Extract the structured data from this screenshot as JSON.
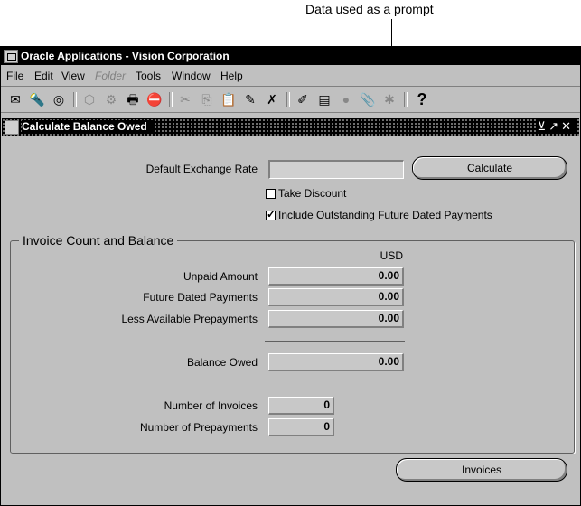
{
  "annotation": {
    "text": "Data used as a prompt"
  },
  "window": {
    "title": "Oracle Applications - Vision Corporation"
  },
  "menu": [
    {
      "label": "File",
      "disabled": false
    },
    {
      "label": "Edit",
      "disabled": false
    },
    {
      "label": "View",
      "disabled": false
    },
    {
      "label": "Folder",
      "disabled": true
    },
    {
      "label": "Tools",
      "disabled": false
    },
    {
      "label": "Window",
      "disabled": false
    },
    {
      "label": "Help",
      "disabled": false
    }
  ],
  "form": {
    "title": "Calculate Balance Owed",
    "exchange_rate_label": "Default Exchange Rate",
    "exchange_rate_value": "",
    "calculate_button": "Calculate",
    "take_discount_label": "Take Discount",
    "take_discount_checked": false,
    "include_future_label": "Include Outstanding Future Dated Payments",
    "include_future_checked": true,
    "group_title": "Invoice Count and Balance",
    "currency": "USD",
    "unpaid_label": "Unpaid Amount",
    "unpaid_value": "0.00",
    "future_label": "Future Dated Payments",
    "future_value": "0.00",
    "prepay_label": "Less Available Prepayments",
    "prepay_value": "0.00",
    "balance_label": "Balance Owed",
    "balance_value": "0.00",
    "num_invoices_label": "Number of Invoices",
    "num_invoices_value": "0",
    "num_prepay_label": "Number of Prepayments",
    "num_prepay_value": "0",
    "invoices_button": "Invoices"
  }
}
